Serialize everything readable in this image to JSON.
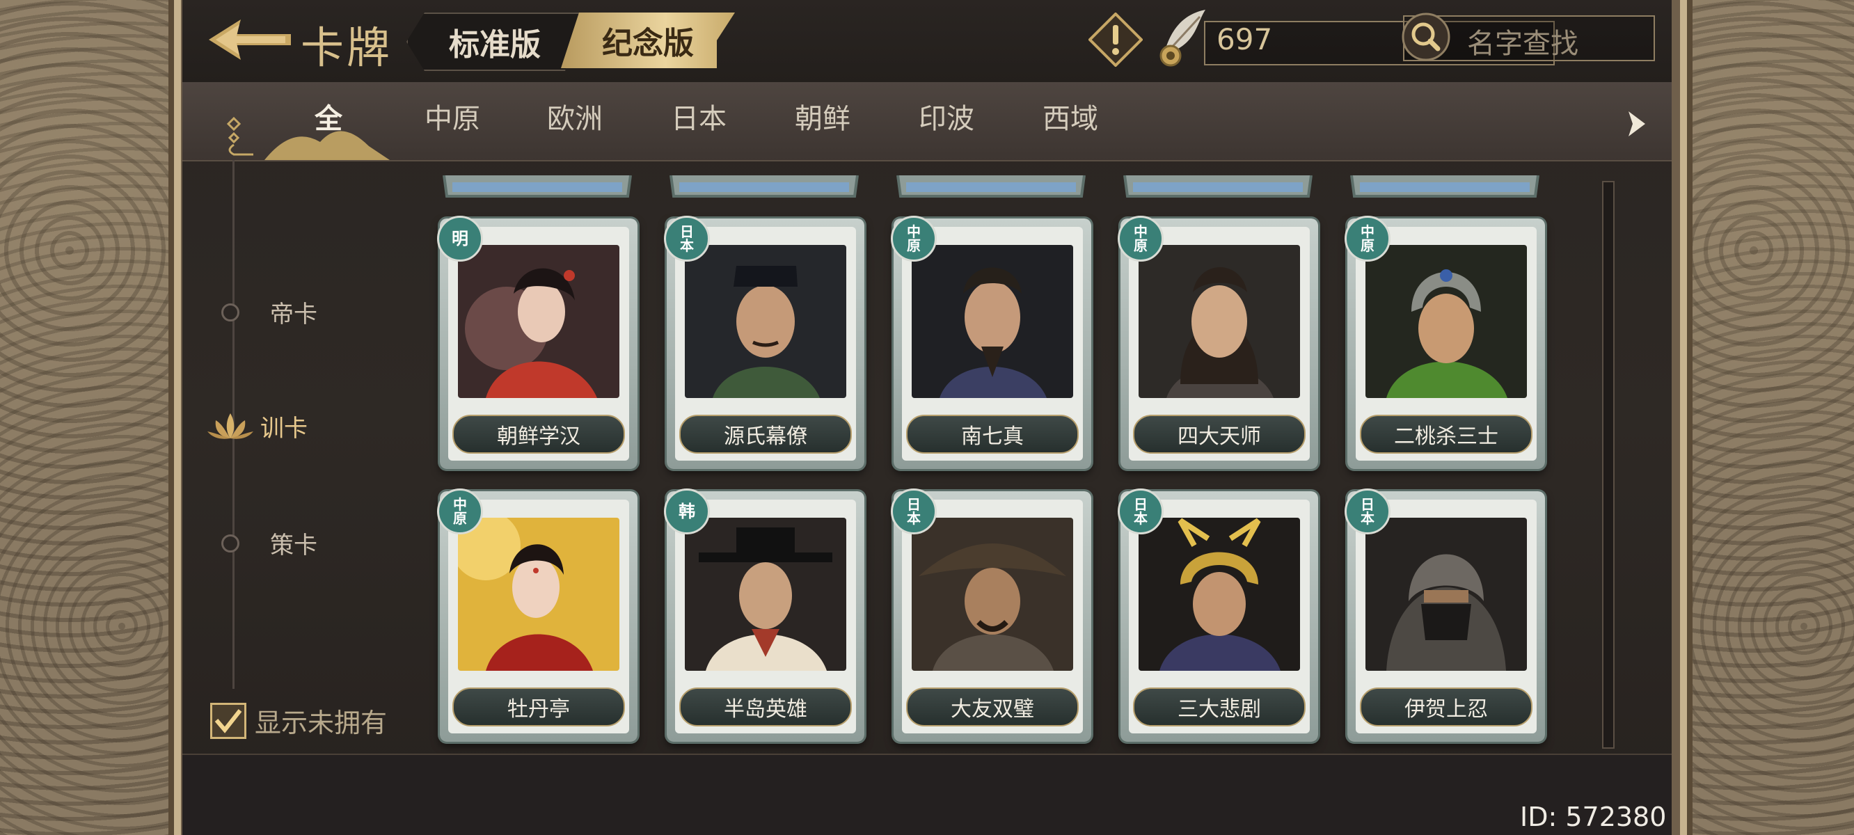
{
  "header": {
    "title": "卡牌",
    "version_tabs": [
      {
        "label": "标准版",
        "active": false
      },
      {
        "label": "纪念版",
        "active": true
      }
    ],
    "currency_value": "697",
    "search_placeholder": "名字查找"
  },
  "category_tabs": [
    {
      "label": "全",
      "active": true
    },
    {
      "label": "中原",
      "active": false
    },
    {
      "label": "欧洲",
      "active": false
    },
    {
      "label": "日本",
      "active": false
    },
    {
      "label": "朝鲜",
      "active": false
    },
    {
      "label": "印波",
      "active": false
    },
    {
      "label": "西域",
      "active": false
    }
  ],
  "filters": [
    {
      "label": "帝卡",
      "active": false
    },
    {
      "label": "训卡",
      "active": true
    },
    {
      "label": "策卡",
      "active": false
    }
  ],
  "show_unowned": {
    "label": "显示未拥有",
    "checked": true
  },
  "cards": [
    {
      "name": "朝鲜学汉",
      "badge": "明"
    },
    {
      "name": "源氏幕僚",
      "badge": "日本"
    },
    {
      "name": "南七真",
      "badge": "中原"
    },
    {
      "name": "四大天师",
      "badge": "中原"
    },
    {
      "name": "二桃杀三士",
      "badge": "中原"
    },
    {
      "name": "牡丹亭",
      "badge": "中原"
    },
    {
      "name": "半岛英雄",
      "badge": "韩"
    },
    {
      "name": "大友双璧",
      "badge": "日本"
    },
    {
      "name": "三大悲剧",
      "badge": "日本"
    },
    {
      "name": "伊贺上忍",
      "badge": "日本"
    }
  ],
  "footer": {
    "id_text": "ID: 572380"
  },
  "colors": {
    "gold": "#d8c08c",
    "badge_teal": "#3a8077",
    "panel_dark": "#2a2522"
  }
}
